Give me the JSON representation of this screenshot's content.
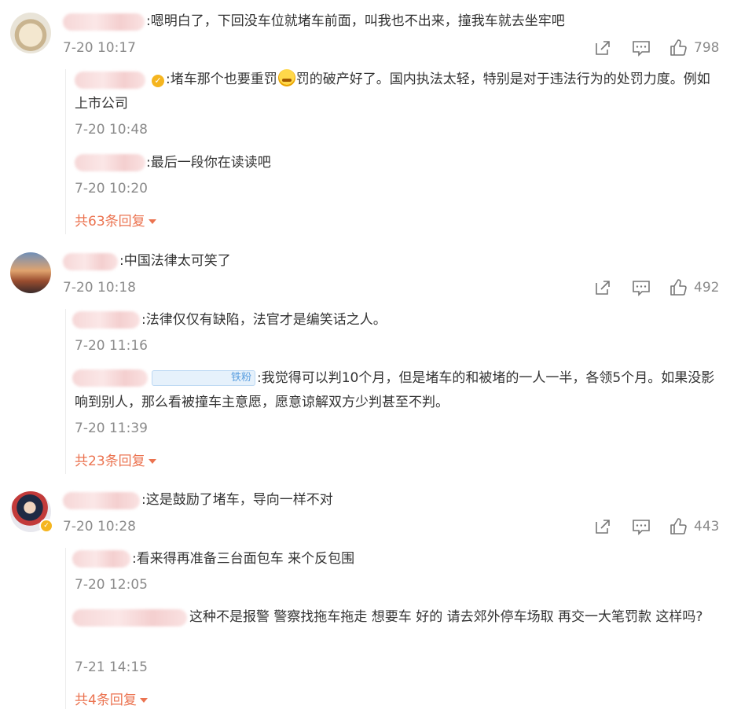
{
  "comments": [
    {
      "text": ":嗯明白了，下回没车位就堵车前面，叫我也不出来，撞我车就去坐牢吧",
      "time": "7-20 10:17",
      "likes": "798",
      "replies": [
        {
          "text_a": ":堵车那个也要重罚",
          "text_b": "罚的破产好了。国内执法太轻，特别是对于违法行为的处罚力度。例如上市公司",
          "time": "7-20 10:48"
        },
        {
          "text": ":最后一段你在读读吧",
          "time": "7-20 10:20"
        }
      ],
      "more": "共63条回复"
    },
    {
      "text": ":中国法律太可笑了",
      "time": "7-20 10:18",
      "likes": "492",
      "replies": [
        {
          "text": ":法律仅仅有缺陷，法官才是编笑话之人。",
          "time": "7-20 11:16"
        },
        {
          "tag": "铁粉",
          "text": ":我觉得可以判10个月，但是堵车的和被堵的一人一半，各领5个月。如果没影响到别人，那么看被撞车主意愿，愿意谅解双方少判甚至不判。",
          "time": "7-20 11:39"
        }
      ],
      "more": "共23条回复"
    },
    {
      "text": ":这是鼓励了堵车，导向一样不对",
      "time": "7-20 10:28",
      "likes": "443",
      "replies": [
        {
          "text": ":看来得再准备三台面包车 来个反包围",
          "time": "7-20 12:05"
        },
        {
          "text": "这种不是报警 警察找拖车拖走 想要车 好的 请去郊外停车场取 再交一大笔罚款 这样吗?",
          "time": "7-21 14:15"
        }
      ],
      "more": "共4条回复"
    }
  ],
  "icons": {
    "share": "share-icon",
    "comment": "comment-icon",
    "like": "thumbs-up-icon",
    "verified": "verified-badge-icon",
    "emoji": "crying-laugh-emoji-icon"
  },
  "colors": {
    "text": "#333333",
    "time": "#8a8a8a",
    "more": "#eb7350",
    "tag": "#5b9fe0"
  }
}
